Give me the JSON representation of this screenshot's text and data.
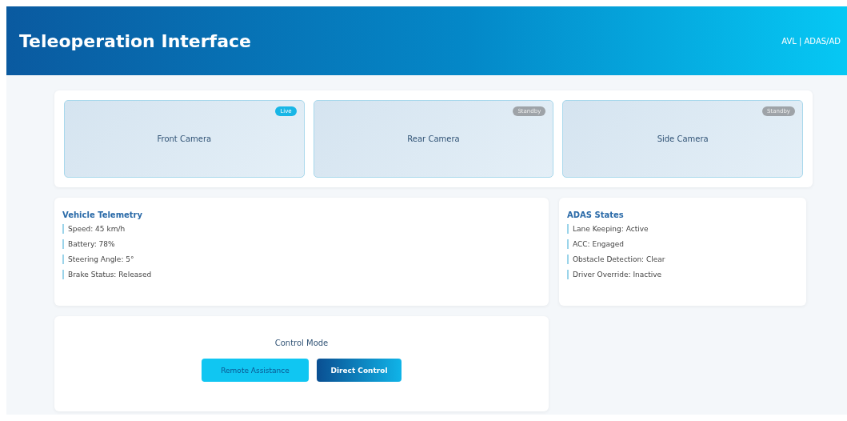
{
  "header": {
    "title": "Teleoperation Interface",
    "subtitle": "AVL | ADAS/AD"
  },
  "cameras": [
    {
      "label": "Front Camera",
      "status": "Live",
      "live": true
    },
    {
      "label": "Rear Camera",
      "status": "Standby",
      "live": false
    },
    {
      "label": "Side Camera",
      "status": "Standby",
      "live": false
    }
  ],
  "telemetry": {
    "title": "Vehicle Telemetry",
    "items": [
      "Speed: 45 km/h",
      "Battery: 78%",
      "Steering Angle: 5°",
      "Brake Status: Released"
    ]
  },
  "adas": {
    "title": "ADAS States",
    "items": [
      "Lane Keeping: Active",
      "ACC: Engaged",
      "Obstacle Detection: Clear",
      "Driver Override: Inactive"
    ]
  },
  "control": {
    "title": "Control Mode",
    "modes": [
      {
        "label": "Remote Assistance",
        "selected": false
      },
      {
        "label": "Direct Control",
        "selected": true
      }
    ]
  }
}
